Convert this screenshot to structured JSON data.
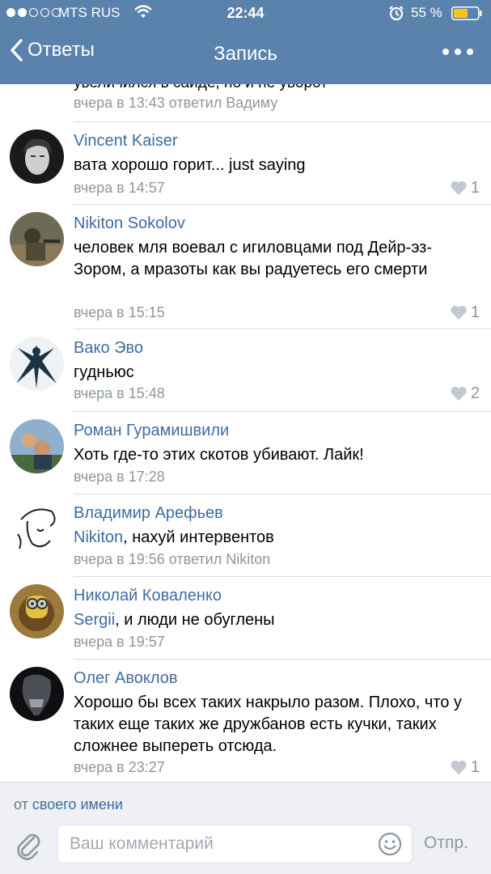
{
  "status_bar": {
    "carrier": "MTS RUS",
    "time": "22:44",
    "battery": "55 %",
    "signal_bars": 2
  },
  "nav": {
    "back_label": "Ответы",
    "title": "Запись"
  },
  "partial_comment": {
    "text": "увеличился в сайде, но и не уворот",
    "meta": "вчера в 13:43 ответил Вадиму"
  },
  "comments": [
    {
      "author": "Vincent Kaiser",
      "text": "вата хорошо горит... just saying",
      "meta": "вчера в 14:57",
      "likes": "1"
    },
    {
      "author": "Nikiton Sokolov",
      "text": "человек мля воевал с игиловцами под Дейр-эз-Зором, а мразоты как вы радуетесь его смерти",
      "meta": "вчера в 15:15",
      "likes": "1"
    },
    {
      "author": "Вако Эво",
      "text": "гудньюс",
      "meta": "вчера в 15:48",
      "likes": "2"
    },
    {
      "author": "Роман Гурамишвили",
      "text": "Хоть где-то этих скотов убивают. Лайк!",
      "meta": "вчера в 17:28"
    },
    {
      "author": "Владимир Арефьев",
      "mention": "Nikiton",
      "text": ", нахуй интервентов",
      "meta": "вчера в 19:56 ответил Nikiton"
    },
    {
      "author": "Николай Коваленко",
      "mention": "Sergii",
      "text": ", и люди не обуглены",
      "meta": "вчера в 19:57"
    },
    {
      "author": "Олег Авоклов",
      "text": "Хорошо бы всех таких накрыло разом. Плохо, что у таких еще таких же дружбанов есть кучки, таких сложнее выпереть отсюда.",
      "meta": "вчера в 23:27",
      "likes": "1"
    }
  ],
  "from_row": {
    "prefix": "от",
    "link": "своего имени"
  },
  "composer": {
    "placeholder": "Ваш комментарий",
    "send_label": "Отпр."
  },
  "colors": {
    "nav_bar": "#5b82ad",
    "link": "#3e6ca1",
    "meta": "#8d969f"
  }
}
